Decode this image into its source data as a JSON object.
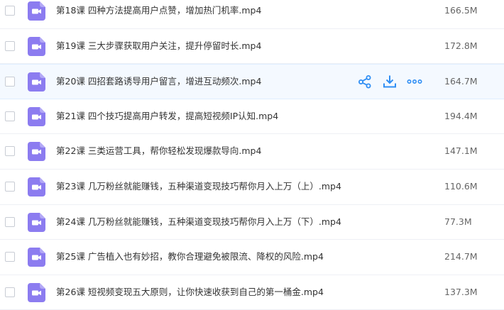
{
  "colors": {
    "accent": "#2f8ef4",
    "icon_purple": "#8c7cf0",
    "hover_row": "#f4f9ff"
  },
  "row_actions": {
    "share_icon": "share-icon",
    "download_icon": "download-icon",
    "more_icon": "more-icon"
  },
  "files": [
    {
      "name": "第18课 四种方法提高用户点赞，增加热门机率.mp4",
      "size": "166.5M"
    },
    {
      "name": "第19课 三大步骤获取用户关注，提升停留时长.mp4",
      "size": "172.8M"
    },
    {
      "name": "第20课 四招套路诱导用户留言，增进互动频次.mp4",
      "size": "164.7M"
    },
    {
      "name": "第21课 四个技巧提高用户转发，提高短视频IP认知.mp4",
      "size": "194.4M"
    },
    {
      "name": "第22课 三类运营工具，帮你轻松发现爆款导向.mp4",
      "size": "147.1M"
    },
    {
      "name": "第23课 几万粉丝就能赚钱，五种渠道变现技巧帮你月入上万（上）.mp4",
      "size": "110.6M"
    },
    {
      "name": "第24课 几万粉丝就能赚钱，五种渠道变现技巧帮你月入上万（下）.mp4",
      "size": "77.3M"
    },
    {
      "name": "第25课 广告植入也有妙招，教你合理避免被限流、降权的风险.mp4",
      "size": "214.7M"
    },
    {
      "name": "第26课 短视频变现五大原则，让你快速收获到自己的第一桶金.mp4",
      "size": "137.3M"
    }
  ]
}
